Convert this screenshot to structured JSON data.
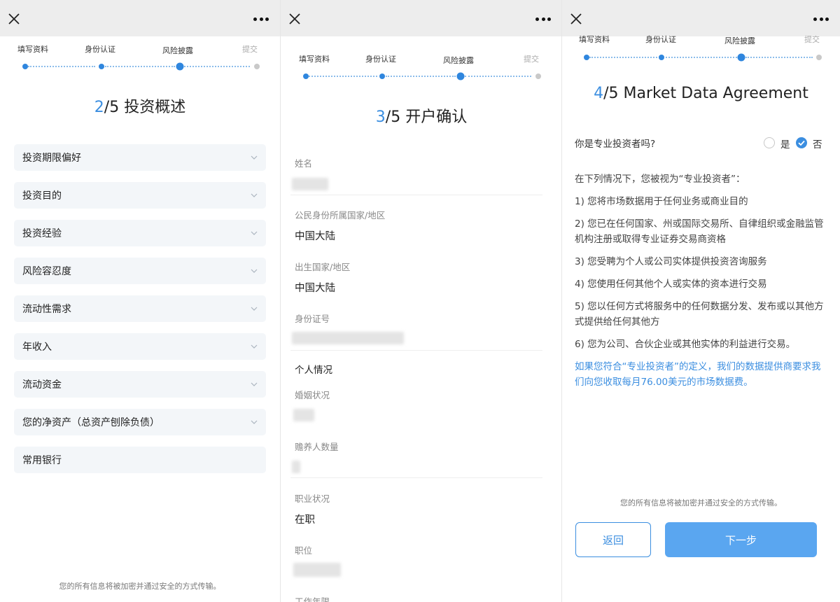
{
  "steps": [
    {
      "label": "填写资料"
    },
    {
      "label": "身份认证"
    },
    {
      "label": "风险披露"
    },
    {
      "label": "提交"
    }
  ],
  "screen1": {
    "title_num": "2",
    "title_rest": "/5 投资概述",
    "items": [
      {
        "label": "投资期限偏好"
      },
      {
        "label": "投资目的"
      },
      {
        "label": "投资经验"
      },
      {
        "label": "风险容忍度"
      },
      {
        "label": "流动性需求"
      },
      {
        "label": "年收入"
      },
      {
        "label": "流动资金"
      },
      {
        "label": "您的净资产（总资产刨除负债）"
      },
      {
        "label": "常用银行"
      }
    ],
    "footer": "您的所有信息将被加密并通过安全的方式传输。"
  },
  "screen2": {
    "title_num": "3",
    "title_rest": "/5 开户确认",
    "name_label": "姓名",
    "citizenship_label": "公民身份所属国家/地区",
    "citizenship_value": "中国大陆",
    "birth_country_label": "出生国家/地区",
    "birth_country_value": "中国大陆",
    "id_label": "身份证号",
    "section_personal": "个人情况",
    "marital_label": "婚姻状况",
    "dependents_label": "赡养人数量",
    "employment_label": "职业状况",
    "employment_value": "在职",
    "position_label": "职位",
    "work_years_label": "工作年限"
  },
  "screen3": {
    "title_num": "4",
    "title_rest": "/5 Market Data Agreement",
    "question": "你是专业投资者吗?",
    "yes_label": "是",
    "no_label": "否",
    "selected": "否",
    "intro": "在下列情况下，您被视为“专业投资者”：",
    "conditions": [
      "1) 您将市场数据用于任何业务或商业目的",
      "2) 您已在任何国家、州或国际交易所、自律组织或金融监管机构注册或取得专业证券交易商资格",
      "3) 您受聘为个人或公司实体提供投资咨询服务",
      "4) 您使用任何其他个人或实体的资本进行交易",
      "5) 您以任何方式将服务中的任何数据分发、发布或以其他方式提供给任何其他方",
      "6) 您为公司、合伙企业或其他实体的利益进行交易。"
    ],
    "fee_notice": "如果您符合“专业投资者”的定义，我们的数据提供商要求我们向您收取每月76.00美元的市场数据费。",
    "footer": "您的所有信息将被加密并通过安全的方式传输。",
    "back_label": "返回",
    "next_label": "下一步"
  },
  "colors": {
    "accent": "#3b8ee0",
    "button_primary": "#5aa6f0",
    "topbar": "#ededed",
    "field_bg": "#f3f6f9"
  }
}
